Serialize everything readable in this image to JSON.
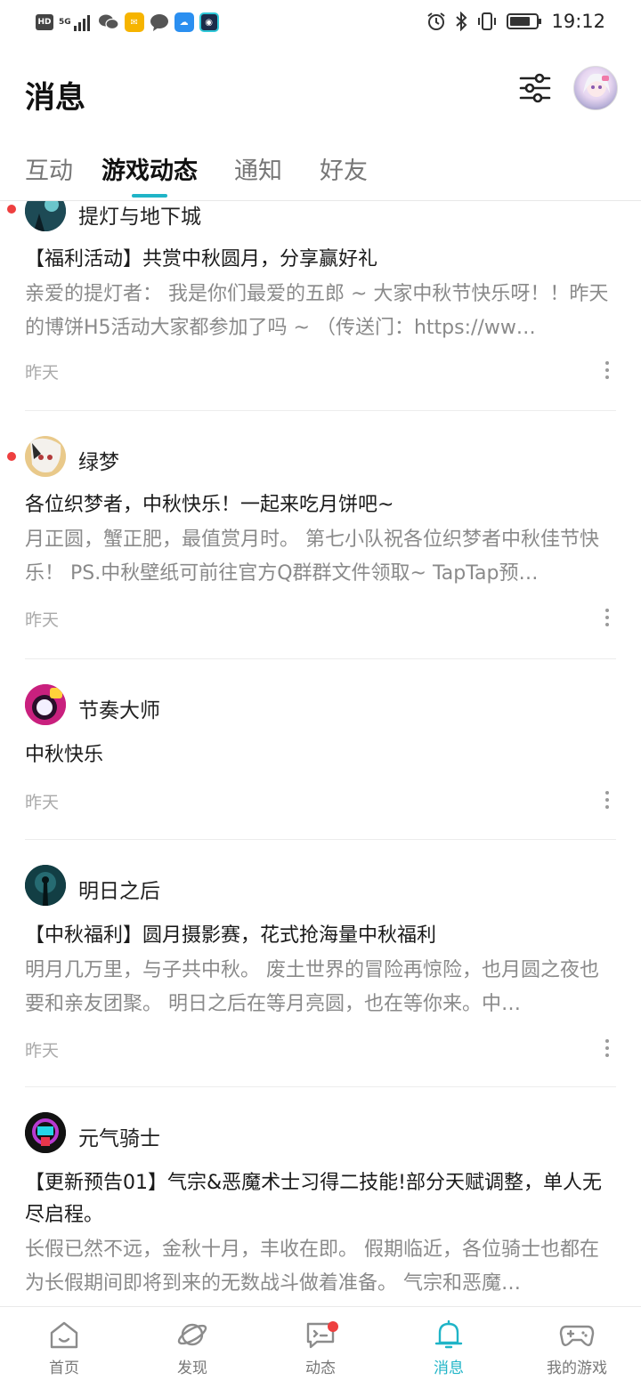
{
  "status_bar": {
    "hd": "HD",
    "network": "5G",
    "time": "19:12"
  },
  "header": {
    "title": "消息"
  },
  "tabs": [
    {
      "label": "互动",
      "active": false
    },
    {
      "label": "游戏动态",
      "active": true
    },
    {
      "label": "通知",
      "active": false
    },
    {
      "label": "好友",
      "active": false
    }
  ],
  "posts": [
    {
      "game": "提灯与地下城",
      "unread": true,
      "title": "【福利活动】共赏中秋圆月，分享赢好礼",
      "body": "亲爱的提灯者： 我是你们最爱的五郎 ~ 大家中秋节快乐呀！！昨天的博饼H5活动大家都参加了吗 ~ （传送门：https://ww…",
      "time": "昨天"
    },
    {
      "game": "绿梦",
      "unread": true,
      "title": "各位织梦者，中秋快乐！一起来吃月饼吧~",
      "body": "月正圆，蟹正肥，最值赏月时。 第七小队祝各位织梦者中秋佳节快乐！ PS.中秋壁纸可前往官方Q群群文件领取~ TapTap预…",
      "time": "昨天"
    },
    {
      "game": "节奏大师",
      "unread": false,
      "title": "中秋快乐",
      "body": "",
      "time": "昨天"
    },
    {
      "game": "明日之后",
      "unread": false,
      "title": "【中秋福利】圆月摄影赛，花式抢海量中秋福利",
      "body": "明月几万里，与子共中秋。 废土世界的冒险再惊险，也月圆之夜也要和亲友团聚。 明日之后在等月亮圆，也在等你来。中…",
      "time": "昨天"
    },
    {
      "game": "元气骑士",
      "unread": false,
      "title": "【更新预告01】气宗&恶魔术士习得二技能!部分天赋调整，单人无尽启程。",
      "body": "长假已然不远，金秋十月，丰收在即。 假期临近，各位骑士也都在为长假期间即将到来的无数战斗做着准备。 气宗和恶魔…",
      "time": ""
    }
  ],
  "bottom_nav": [
    {
      "label": "首页",
      "icon": "home-icon",
      "active": false
    },
    {
      "label": "发现",
      "icon": "planet-icon",
      "active": false
    },
    {
      "label": "动态",
      "icon": "chat-icon",
      "active": false,
      "badge": true
    },
    {
      "label": "消息",
      "icon": "bell-icon",
      "active": true
    },
    {
      "label": "我的游戏",
      "icon": "gamepad-icon",
      "active": false
    }
  ],
  "colors": {
    "accent": "#1fb4c7",
    "badge": "#ee3f3f",
    "muted_text": "#8a8a8a"
  }
}
